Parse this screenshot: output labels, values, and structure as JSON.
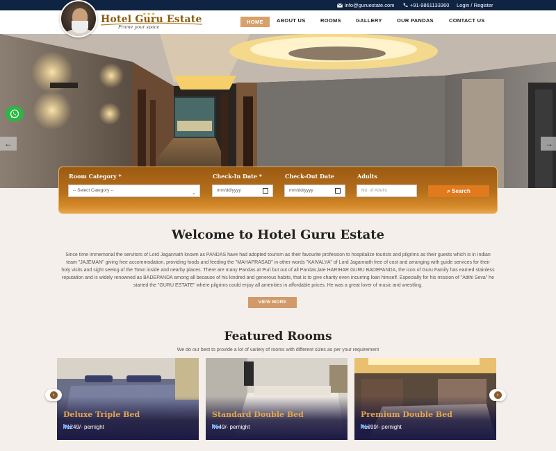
{
  "topbar": {
    "email": "info@guruestate.com",
    "phone": "+91-9861133360",
    "login": "Login / Register"
  },
  "brand": {
    "name": "Hotel Guru Estate",
    "tagline": "Frame your space",
    "stars": "★★★"
  },
  "nav": {
    "home": "HOME",
    "about": "ABOUT US",
    "rooms": "ROOMS",
    "gallery": "GALLERY",
    "pandas": "OUR PANDAS",
    "contact": "CONTACT US"
  },
  "hero": {
    "prev": "←",
    "next": "→"
  },
  "search": {
    "room_category_label": "Room Category *",
    "room_category_value": "-- Select Category --",
    "checkin_label": "Check-In Date *",
    "checkin_value": "mm/dd/yyyy",
    "checkout_label": "Check-Out Date",
    "checkout_value": "mm/dd/yyyy",
    "adults_label": "Adults",
    "adults_placeholder": "No. of Adults",
    "button": "Search"
  },
  "welcome": {
    "title": "Welcome to Hotel Guru Estate",
    "body": "Since time immemorial the servitors of Lord Jagannath known as PANDAS have had adopted tourism as their favourite profession to hospitalize tourists and pilgrims as their guests which is in Indian team \"JAJEMAN\" giving free accommodation, providing foods and feeding the \"MAHAPRASAD\" in other words \"KAIVALYA\" of Lord Jagannath free of cost and arranging with guide services for their holy visits and sight seeing of the Town inside and nearby places. There are many Pandas at Puri but out of all Pandas,late HARIHAR GURU BADEPANDA, the icon of Guru Family has earned stainless reputation and is widely renowned as BADEPANDA among all because of his kindred and generous habits, that is to give charity even incurring loan himself. Especially for his mission of \"Atithi Seva\" he started the \"GURU ESTATE\" where pilgrims could enjoy all amenities in affordable prices. He was a great lover of music and wrestling.",
    "button": "VIEW MORE"
  },
  "featured": {
    "title": "Featured Rooms",
    "subtitle": "We do our best to provide a lot of variety of rooms with different sizes as per your requirement",
    "rooms": [
      {
        "name": "Deluxe Triple Bed",
        "price": "₹1249/- pernight"
      },
      {
        "name": "Standard Double Bed",
        "price": "₹649/- pernight"
      },
      {
        "name": "Premium Double Bed",
        "price": "₹1999/- pernight"
      }
    ],
    "prev": "‹",
    "next": "›"
  },
  "colors": {
    "topbar": "#0f2342",
    "accent": "#d8a06a",
    "search_btn": "#e07a1c",
    "room_name": "#e6a64e"
  }
}
